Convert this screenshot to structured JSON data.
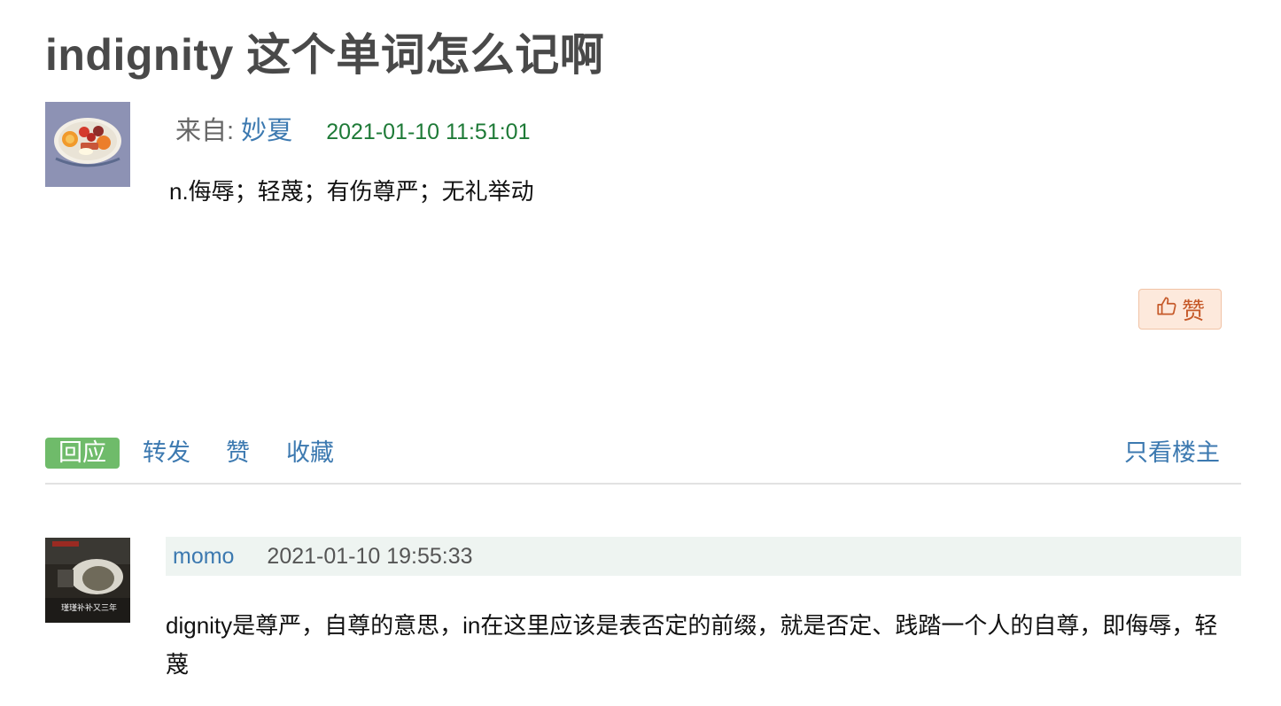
{
  "post": {
    "title": "indignity 这个单词怎么记啊",
    "from_label": "来自:",
    "author": "妙夏",
    "timestamp": "2021-01-10 11:51:01",
    "body": "n.侮辱；轻蔑；有伤尊严；无礼举动",
    "like_label": "赞"
  },
  "actions": {
    "reply": "回应",
    "forward": "转发",
    "like": "赞",
    "favorite": "收藏",
    "only_owner": "只看楼主"
  },
  "reply": {
    "author": "momo",
    "timestamp": "2021-01-10 19:55:33",
    "body": "dignity是尊严，自尊的意思，in在这里应该是表否定的前缀，就是否定、践踏一个人的自尊，即侮辱，轻蔑",
    "avatar_caption": "瑾瑾补补又三年"
  },
  "colors": {
    "link": "#3c79b0",
    "timestamp_green": "#1e7a37",
    "reply_button": "#6fbb6a",
    "like_button_bg": "#fde9dc",
    "like_button_text": "#c65a2a"
  },
  "icons": {
    "like": "thumbs-up-icon"
  }
}
